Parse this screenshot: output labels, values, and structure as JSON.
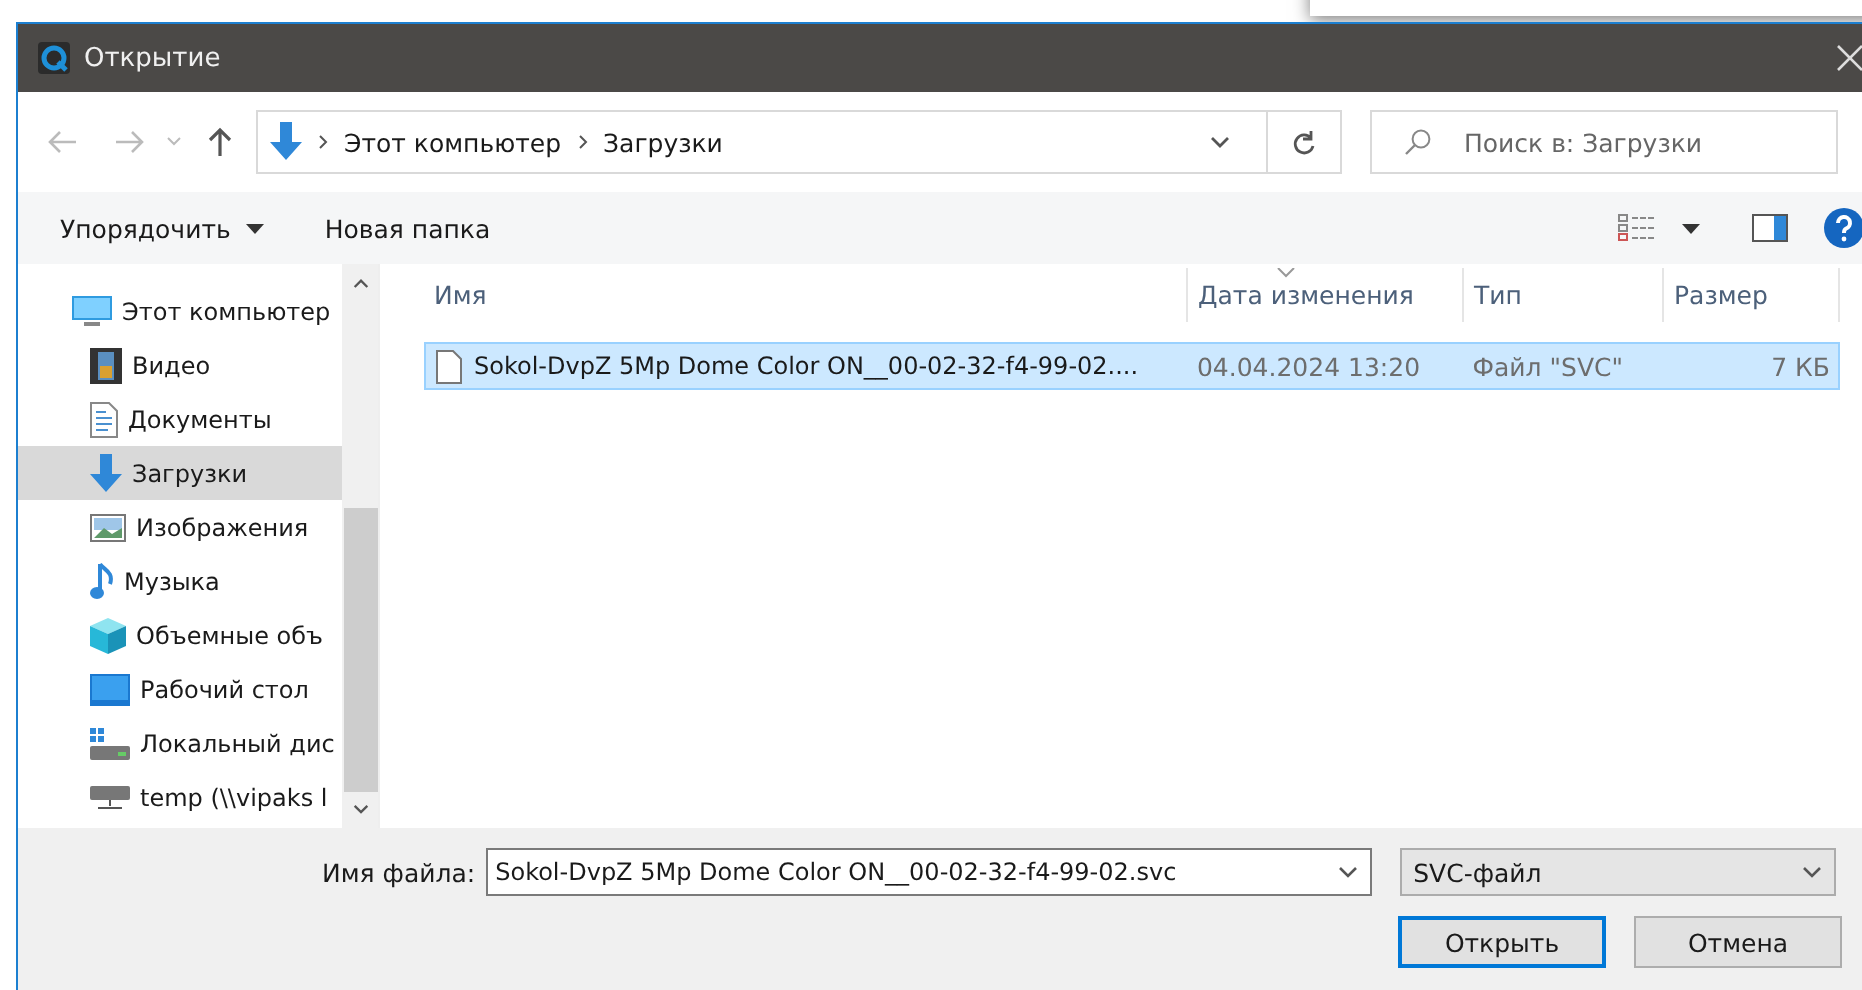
{
  "window": {
    "title": "Открытие"
  },
  "address": {
    "path": [
      "Этот компьютер",
      "Загрузки"
    ]
  },
  "search": {
    "placeholder": "Поиск в: Загрузки"
  },
  "toolbar": {
    "organize": "Упорядочить",
    "new_folder": "Новая папка"
  },
  "sidebar": {
    "items": [
      {
        "label": "Этот компьютер",
        "selected": false,
        "children": [
          {
            "label": "Видео",
            "selected": false
          },
          {
            "label": "Документы",
            "selected": false
          },
          {
            "label": "Загрузки",
            "selected": true
          },
          {
            "label": "Изображения",
            "selected": false
          },
          {
            "label": "Музыка",
            "selected": false
          },
          {
            "label": "Объемные объ",
            "selected": false
          },
          {
            "label": "Рабочий стол",
            "selected": false
          },
          {
            "label": "Локальный дис",
            "selected": false
          },
          {
            "label": "temp (\\\\vipaks l",
            "selected": false
          }
        ]
      }
    ]
  },
  "table": {
    "columns": [
      "Имя",
      "Дата изменения",
      "Тип",
      "Размер"
    ],
    "rows": [
      {
        "cells": [
          "Sokol-DvpZ 5Mp Dome Color ON__00-02-32-f4-99-02....",
          "04.04.2024 13:20",
          "Файл \"SVC\"",
          "7 КБ"
        ],
        "selected": true
      }
    ]
  },
  "footer": {
    "filename_label": "Имя файла:",
    "filename": "Sokol-DvpZ 5Mp Dome Color ON__00-02-32-f4-99-02.svc",
    "filetype": "SVC-файл",
    "buttons": [
      "Открыть",
      "Отмена"
    ]
  }
}
